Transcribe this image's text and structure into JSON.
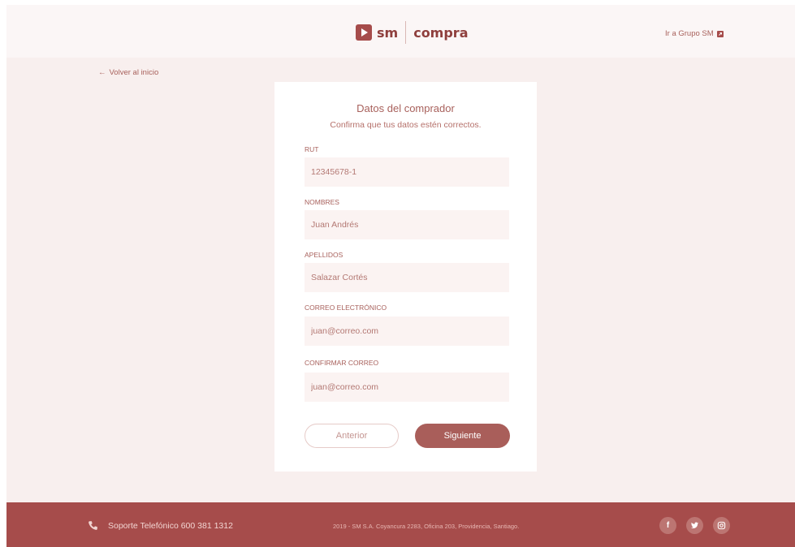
{
  "header": {
    "logo_sm": "sm",
    "logo_compra": "compra",
    "grupo_link": "Ir a Grupo SM"
  },
  "nav": {
    "back_arrow": "←",
    "back_label": "Volver al inicio"
  },
  "card": {
    "title": "Datos del comprador",
    "subtitle": "Confirma que tus datos estén correctos.",
    "fields": [
      {
        "label": "RUT",
        "value": "12345678-1"
      },
      {
        "label": "NOMBRES",
        "value": "Juan Andrés"
      },
      {
        "label": "APELLIDOS",
        "value": "Salazar Cortés"
      },
      {
        "label": "CORREO ELECTRÓNICO",
        "value": "juan@correo.com"
      },
      {
        "label": "CONFIRMAR CORREO",
        "value": "juan@correo.com"
      }
    ],
    "prev_label": "Anterior",
    "next_label": "Siguiente"
  },
  "footer": {
    "support": "Soporte Telefónico 600 381 1312",
    "copyright": "2019 - SM S.A. Coyancura 2283, Oficina 203, Providencia, Santiago.",
    "social": [
      {
        "icon": "facebook-icon",
        "glyph": "f"
      },
      {
        "icon": "twitter-icon",
        "glyph": ""
      },
      {
        "icon": "instagram-icon",
        "glyph": ""
      }
    ]
  },
  "colors": {
    "brand": "#a64c4b",
    "accent_button": "#a95e5a",
    "background": "#f8efee",
    "input_bg": "#fbf3f2"
  }
}
